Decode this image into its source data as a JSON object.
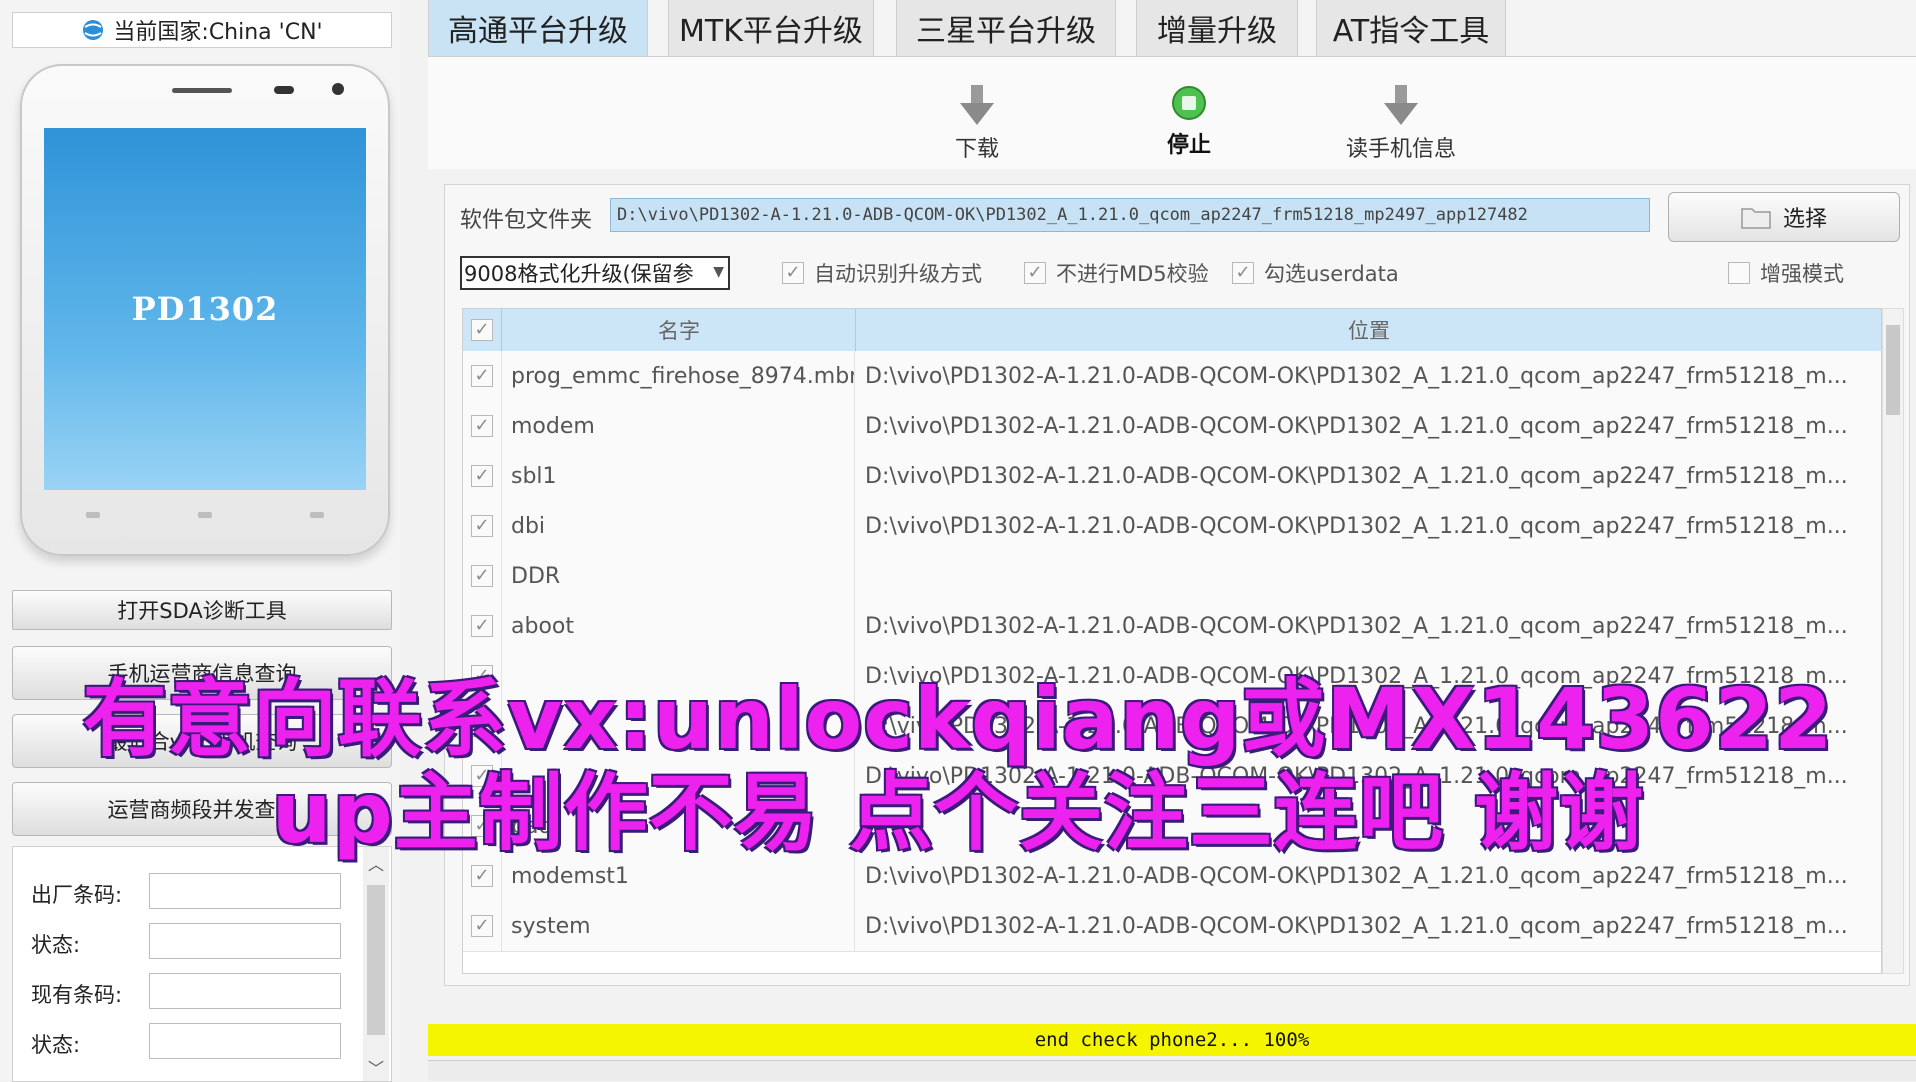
{
  "country_bar": {
    "text": "当前国家:China 'CN'"
  },
  "phone": {
    "model": "PD1302"
  },
  "left_buttons": {
    "sda": "打开SDA诊断工具",
    "operator": "手机运营商信息查询",
    "vivo": "最适合vivo手机查询",
    "band": "运营商频段并发查询"
  },
  "info_fields": [
    {
      "label": "出厂条码:",
      "value": ""
    },
    {
      "label": "状态:",
      "value": ""
    },
    {
      "label": "现有条码:",
      "value": ""
    },
    {
      "label": "状态:",
      "value": ""
    }
  ],
  "tabs": [
    {
      "label": "高通平台升级",
      "active": true
    },
    {
      "label": "MTK平台升级"
    },
    {
      "label": "三星平台升级"
    },
    {
      "label": "增量升级"
    },
    {
      "label": "AT指令工具"
    }
  ],
  "toolbar": {
    "download": "下载",
    "stop": "停止",
    "read_info": "读手机信息"
  },
  "package": {
    "label": "软件包文件夹",
    "path": "D:\\vivo\\PD1302-A-1.21.0-ADB-QCOM-OK\\PD1302_A_1.21.0_qcom_ap2247_frm51218_mp2497_app127482",
    "choose_button": "选择"
  },
  "mode_select": {
    "value": "9008格式化升级(保留参"
  },
  "options": {
    "auto_detect": "自动识别升级方式",
    "no_md5": "不进行MD5校验",
    "userdata": "勾选userdata",
    "enhanced": "增强模式"
  },
  "table": {
    "headers": {
      "name": "名字",
      "location": "位置"
    },
    "rows": [
      {
        "name": "prog_emmc_firehose_8974.mbn",
        "location": "D:\\vivo\\PD1302-A-1.21.0-ADB-QCOM-OK\\PD1302_A_1.21.0_qcom_ap2247_frm51218_m..."
      },
      {
        "name": "modem",
        "location": "D:\\vivo\\PD1302-A-1.21.0-ADB-QCOM-OK\\PD1302_A_1.21.0_qcom_ap2247_frm51218_m..."
      },
      {
        "name": "sbl1",
        "location": "D:\\vivo\\PD1302-A-1.21.0-ADB-QCOM-OK\\PD1302_A_1.21.0_qcom_ap2247_frm51218_m..."
      },
      {
        "name": "dbi",
        "location": "D:\\vivo\\PD1302-A-1.21.0-ADB-QCOM-OK\\PD1302_A_1.21.0_qcom_ap2247_frm51218_m..."
      },
      {
        "name": "DDR",
        "location": ""
      },
      {
        "name": "aboot",
        "location": "D:\\vivo\\PD1302-A-1.21.0-ADB-QCOM-OK\\PD1302_A_1.21.0_qcom_ap2247_frm51218_m..."
      },
      {
        "name": "",
        "location": "D:\\vivo\\PD1302-A-1.21.0-ADB-QCOM-OK\\PD1302_A_1.21.0_qcom_ap2247_frm51218_m..."
      },
      {
        "name": "",
        "location": "D:\\vivo\\PD1302-A-1.21.0-ADB-QCOM-OK\\PD1302_A_1.21.0_qcom_ap2247_frm51218_m..."
      },
      {
        "name": "",
        "location": "D:\\vivo\\PD1302-A-1.21.0-ADB-QCOM-OK\\PD1302_A_1.21.0_qcom_ap2247_frm51218_m..."
      },
      {
        "name": "pad",
        "location": ""
      },
      {
        "name": "modemst1",
        "location": "D:\\vivo\\PD1302-A-1.21.0-ADB-QCOM-OK\\PD1302_A_1.21.0_qcom_ap2247_frm51218_m..."
      },
      {
        "name": "system",
        "location": "D:\\vivo\\PD1302-A-1.21.0-ADB-QCOM-OK\\PD1302_A_1.21.0_qcom_ap2247_frm51218_m..."
      }
    ]
  },
  "status": {
    "text": "end check phone2... 100%"
  },
  "overlay": {
    "line1": "有意向联系vx:unlockqiang或MX143622",
    "line2": "up主制作不易 点个关注三连吧 谢谢"
  },
  "colors": {
    "active_tab": "#c9e3f5",
    "status_bar": "#f5f500",
    "overlay_text": "#ee22ee",
    "path_field": "#c7e2f5"
  }
}
